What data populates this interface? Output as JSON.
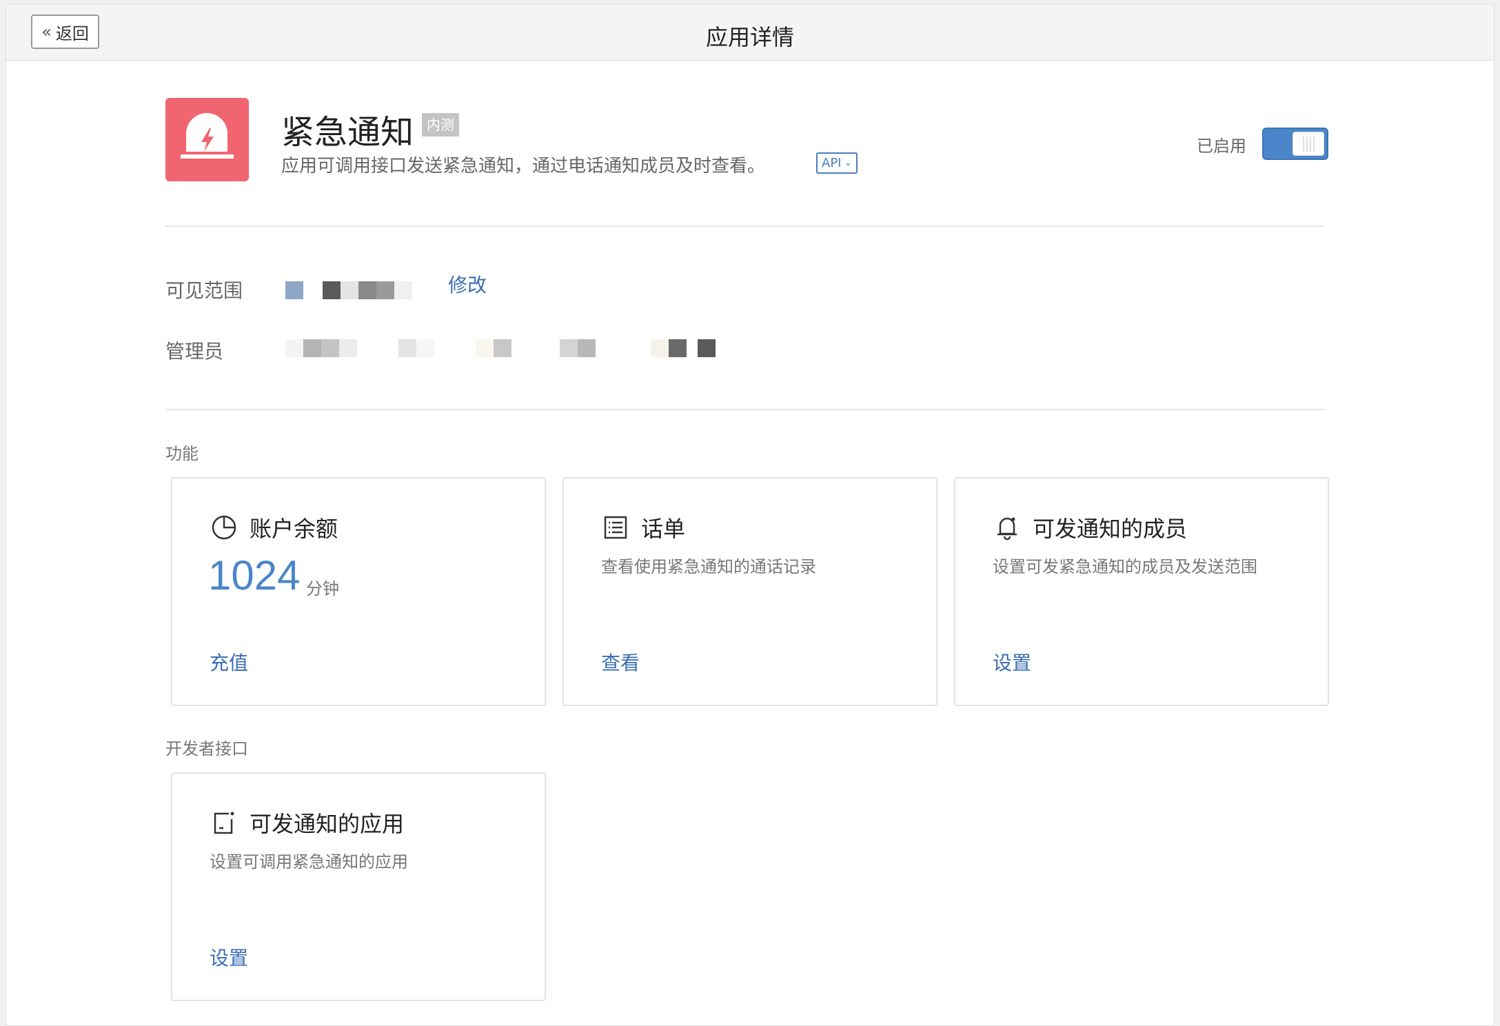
{
  "topbar": {
    "back_label": "返回",
    "title": "应用详情"
  },
  "app": {
    "name": "紧急通知",
    "badge": "内测",
    "description": "应用可调用接口发送紧急通知，通过电话通知成员及时查看。",
    "api_label": "API",
    "status_label": "已启用",
    "enabled": true,
    "icon_color": "#f0656f"
  },
  "fields": {
    "visibility_label": "可见范围",
    "visibility_edit": "修改",
    "admin_label": "管理员"
  },
  "sections": {
    "features_label": "功能",
    "developer_label": "开发者接口"
  },
  "cards": {
    "balance": {
      "title": "账户余额",
      "value": "1024",
      "unit": "分钟",
      "action": "充值"
    },
    "call_log": {
      "title": "话单",
      "desc": "查看使用紧急通知的通话记录",
      "action": "查看"
    },
    "members": {
      "title": "可发通知的成员",
      "desc": "设置可发紧急通知的成员及发送范围",
      "action": "设置"
    },
    "apps": {
      "title": "可发通知的应用",
      "desc": "设置可调用紧急通知的应用",
      "action": "设置"
    }
  },
  "colors": {
    "accent": "#4a86c9",
    "link": "#3b6db5"
  }
}
